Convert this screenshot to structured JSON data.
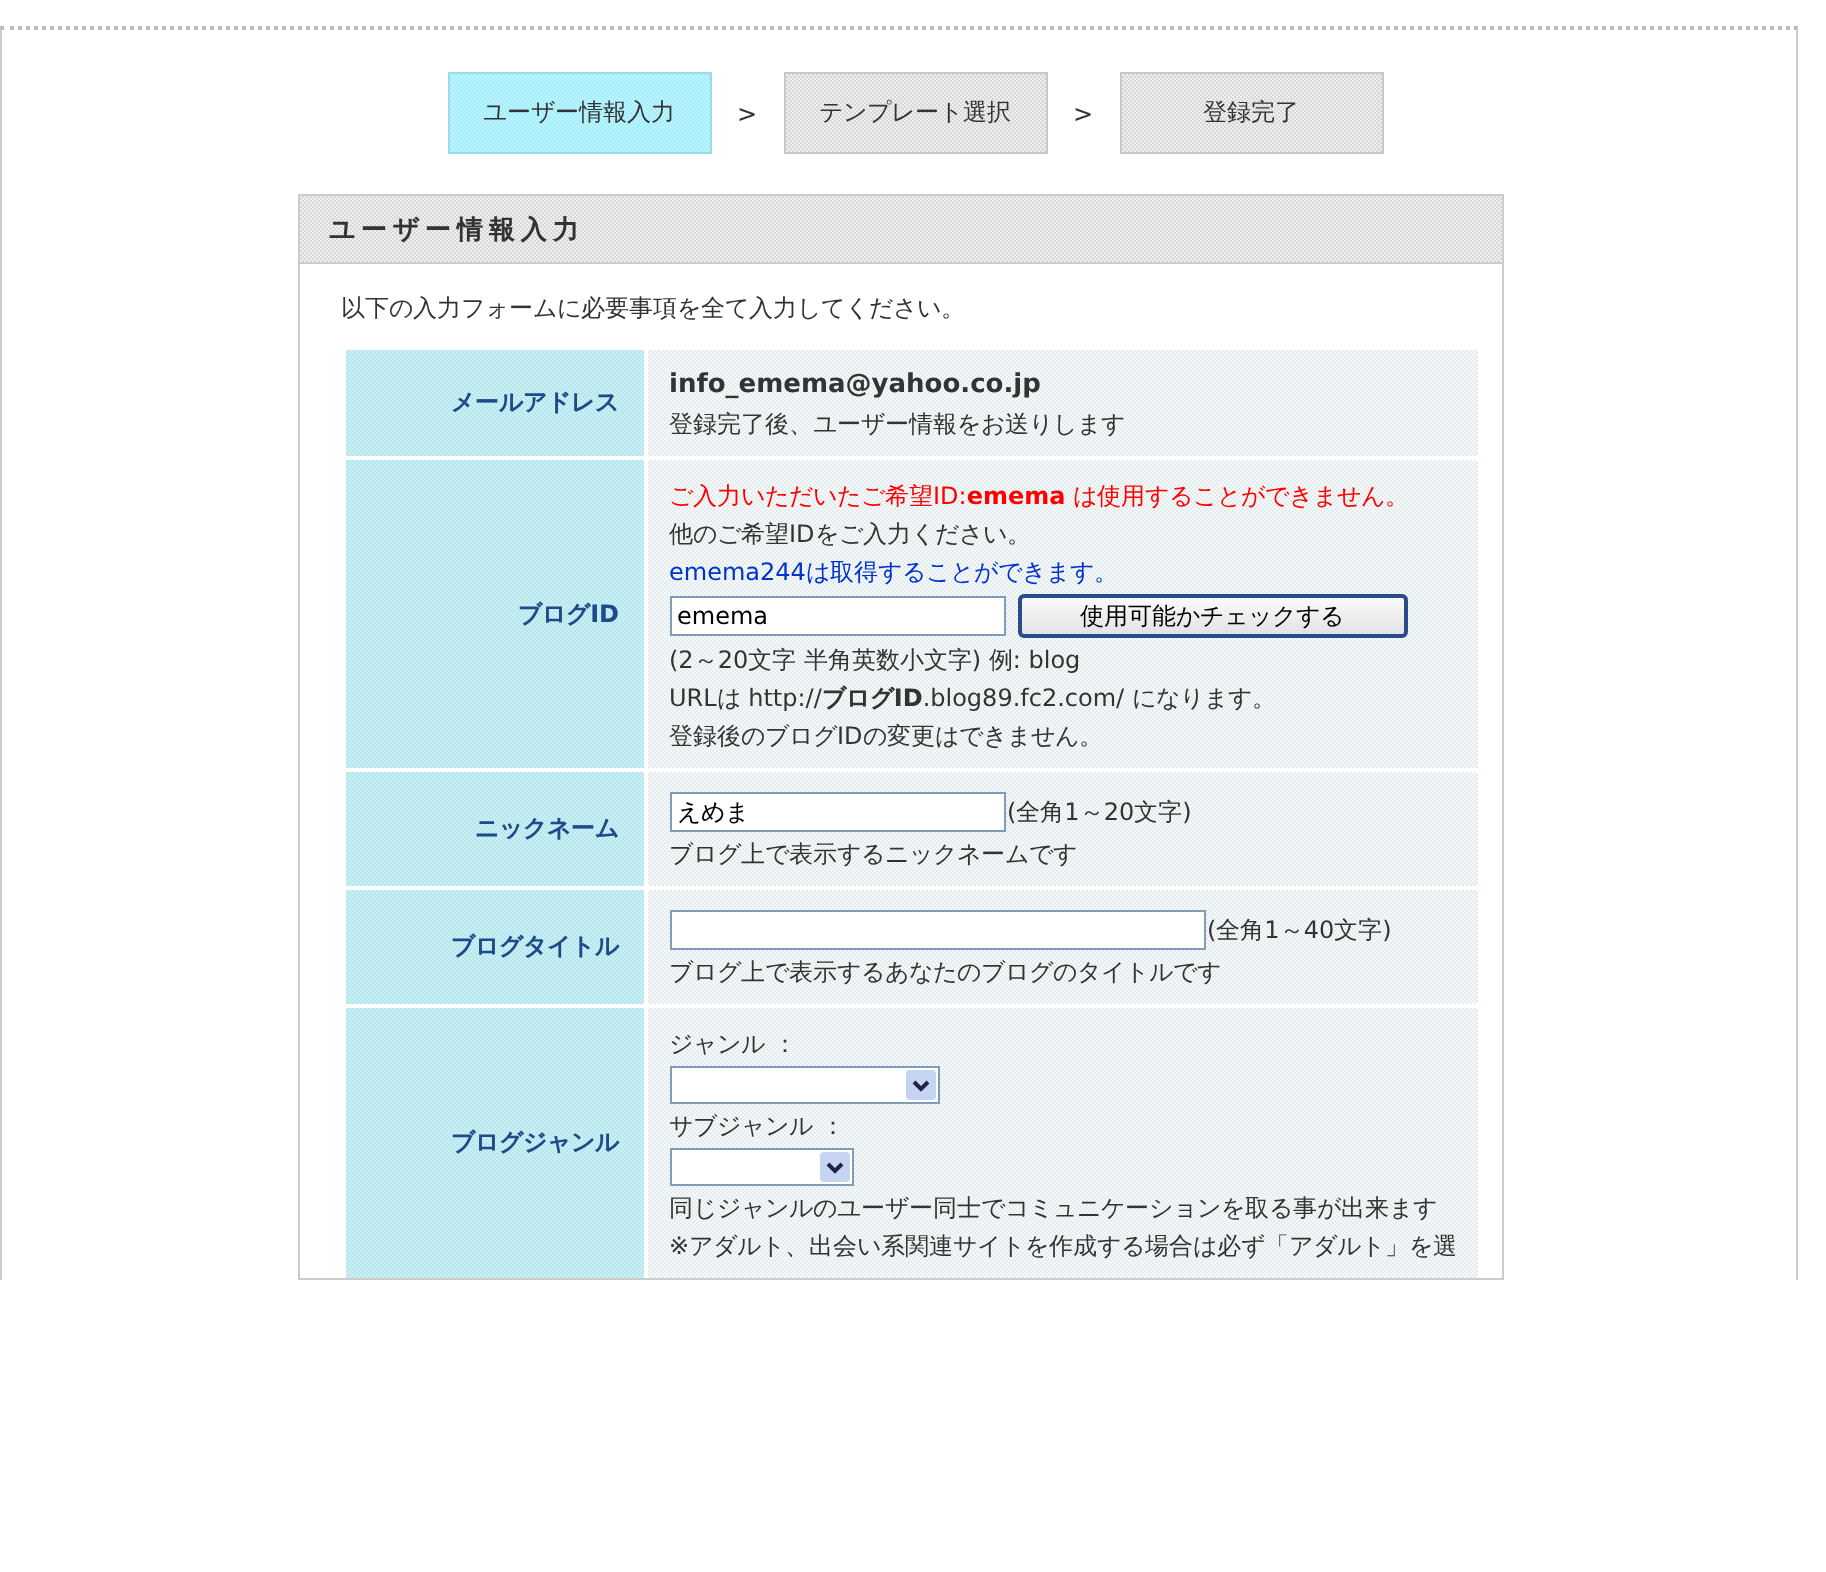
{
  "steps": [
    {
      "label": "ユーザー情報入力",
      "selected": true
    },
    {
      "label": "テンプレート選択",
      "selected": false
    },
    {
      "label": "登録完了",
      "selected": false
    }
  ],
  "step_separators": [
    ">",
    ">"
  ],
  "panel": {
    "title": "ユーザー情報入力",
    "intro": "以下の入力フォームに必要事項を全て入力してください。"
  },
  "rows": [
    {
      "kind": "email",
      "label": "メールアドレス",
      "value": "info_emema@yahoo.co.jp",
      "note": "登録完了後、ユーザー情報をお送りします"
    },
    {
      "kind": "blog_id",
      "label": "ブログID",
      "error": "ご入力いただいたご希望ID:**emema** は使用することができません。",
      "message": "他のご希望IDをご入力ください。",
      "available": "emema244は取得することができます。",
      "value": "emema",
      "button": "使用可能かチェックする",
      "hints": [
        "(2～20文字 半角英数小文字) 例: blog",
        "URLは http://**ブログID**.blog89.fc2.com/ になります。",
        "登録後のブログIDの変更はできません。"
      ]
    },
    {
      "kind": "text",
      "label": "ニックネーム",
      "value": "えめま",
      "limit": "(全角1～20文字)",
      "wide": false,
      "note": "ブログ上で表示するニックネームです"
    },
    {
      "kind": "text",
      "label": "ブログタイトル",
      "value": "",
      "limit": "(全角1～40文字)",
      "note": "ブログ上で表示するあなたのブログのタイトルです",
      "wide": true
    },
    {
      "kind": "genre",
      "label": "ブログジャンル",
      "selects": [
        {
          "label": "ジャンル ："
        },
        {
          "label": "サブジャンル ："
        }
      ],
      "notes": [
        "同じジャンルのユーザー同士でコミュニケーションを取る事が出来ます",
        "※アダルト、出会い系関連サイトを作成する場合は必ず「アダルト」を選"
      ]
    }
  ]
}
